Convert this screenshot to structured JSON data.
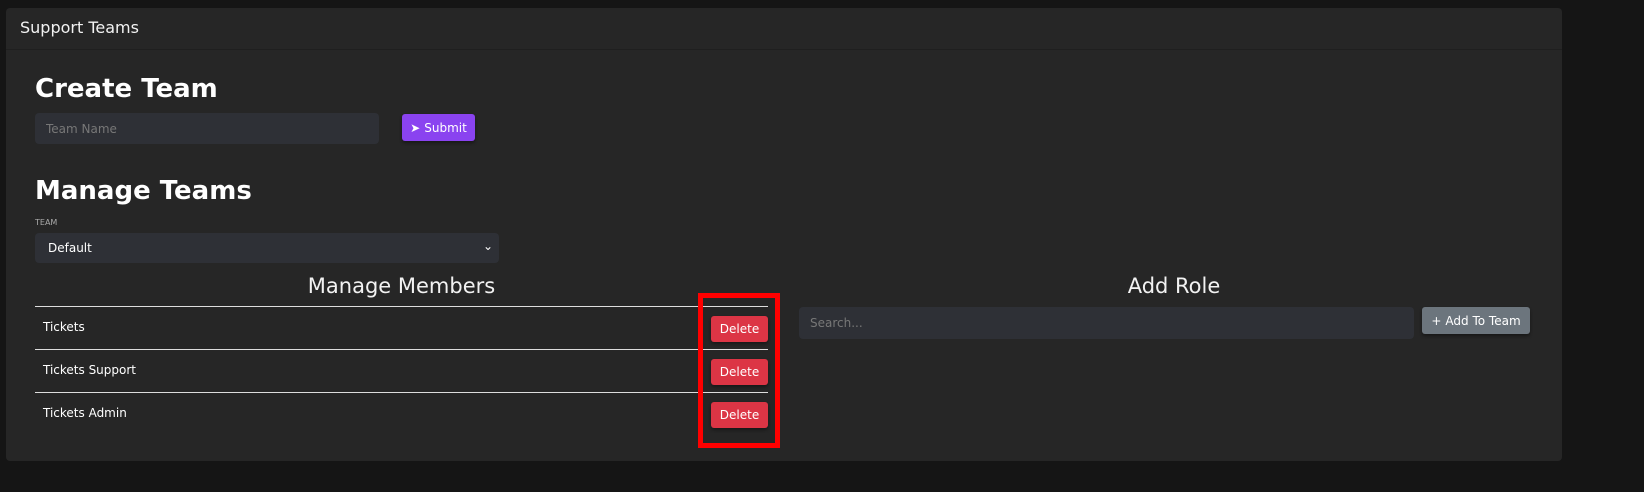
{
  "header": {
    "title": "Support Teams"
  },
  "create": {
    "heading": "Create Team",
    "team_name_placeholder": "Team Name",
    "submit_label": "Submit",
    "submit_color": "#8a43f0"
  },
  "manage": {
    "heading": "Manage Teams",
    "team_label": "TEAM",
    "team_selected": "Default"
  },
  "members": {
    "heading": "Manage Members",
    "items": [
      {
        "name": "Tickets",
        "delete_label": "Delete"
      },
      {
        "name": "Tickets Support",
        "delete_label": "Delete"
      },
      {
        "name": "Tickets Admin",
        "delete_label": "Delete"
      }
    ]
  },
  "add_role": {
    "heading": "Add Role",
    "search_placeholder": "Search...",
    "add_label": "Add To Team"
  },
  "colors": {
    "delete": "#dc3545",
    "highlight": "#ff0000"
  }
}
